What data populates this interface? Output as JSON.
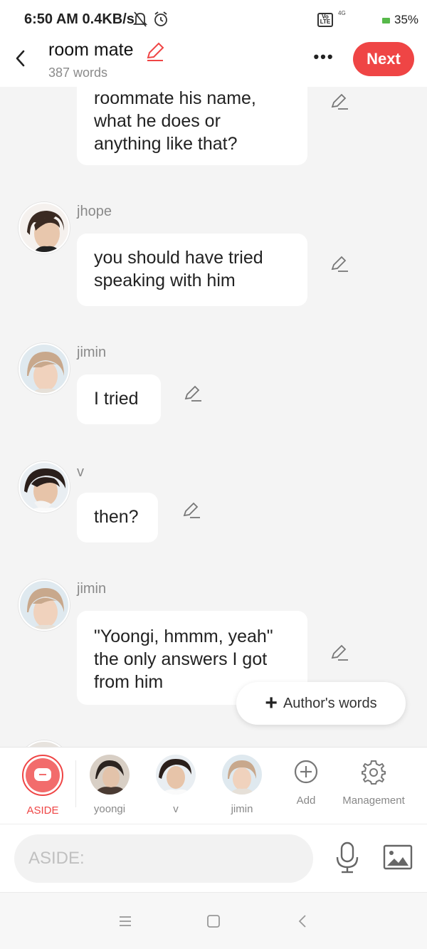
{
  "status_bar": {
    "time": "6:50 AM",
    "speed": "0.4KB/s",
    "volte": "Vo LTE",
    "network": "4G",
    "battery": "35%"
  },
  "header": {
    "title": "room mate",
    "word_count": "387 words",
    "next_label": "Next",
    "accent_color": "#ef4545"
  },
  "messages": [
    {
      "sender": "",
      "text_lines": [
        "roommate his name,",
        "what he does or",
        "anything like that?"
      ]
    },
    {
      "sender": "jhope",
      "text_lines": [
        "you should have tried",
        "speaking with him"
      ]
    },
    {
      "sender": "jimin",
      "text_lines": [
        "I tried"
      ]
    },
    {
      "sender": "v",
      "text_lines": [
        "then?"
      ]
    },
    {
      "sender": "jimin",
      "text_lines": [
        "\"Yoongi, hmmm, yeah\"",
        "the only answers I got",
        "from him"
      ]
    }
  ],
  "authors_words_label": "Author's words",
  "characters": [
    {
      "label": "ASIDE",
      "icon": "chat-bubble-icon"
    },
    {
      "label": "yoongi"
    },
    {
      "label": "v"
    },
    {
      "label": "jimin"
    },
    {
      "label": "Add",
      "icon": "plus-circle-icon"
    },
    {
      "label": "Management",
      "icon": "gear-icon"
    }
  ],
  "input": {
    "placeholder": "ASIDE:"
  },
  "nav": {
    "icons": [
      "menu-icon",
      "home-square-icon",
      "back-arrow-icon"
    ]
  }
}
